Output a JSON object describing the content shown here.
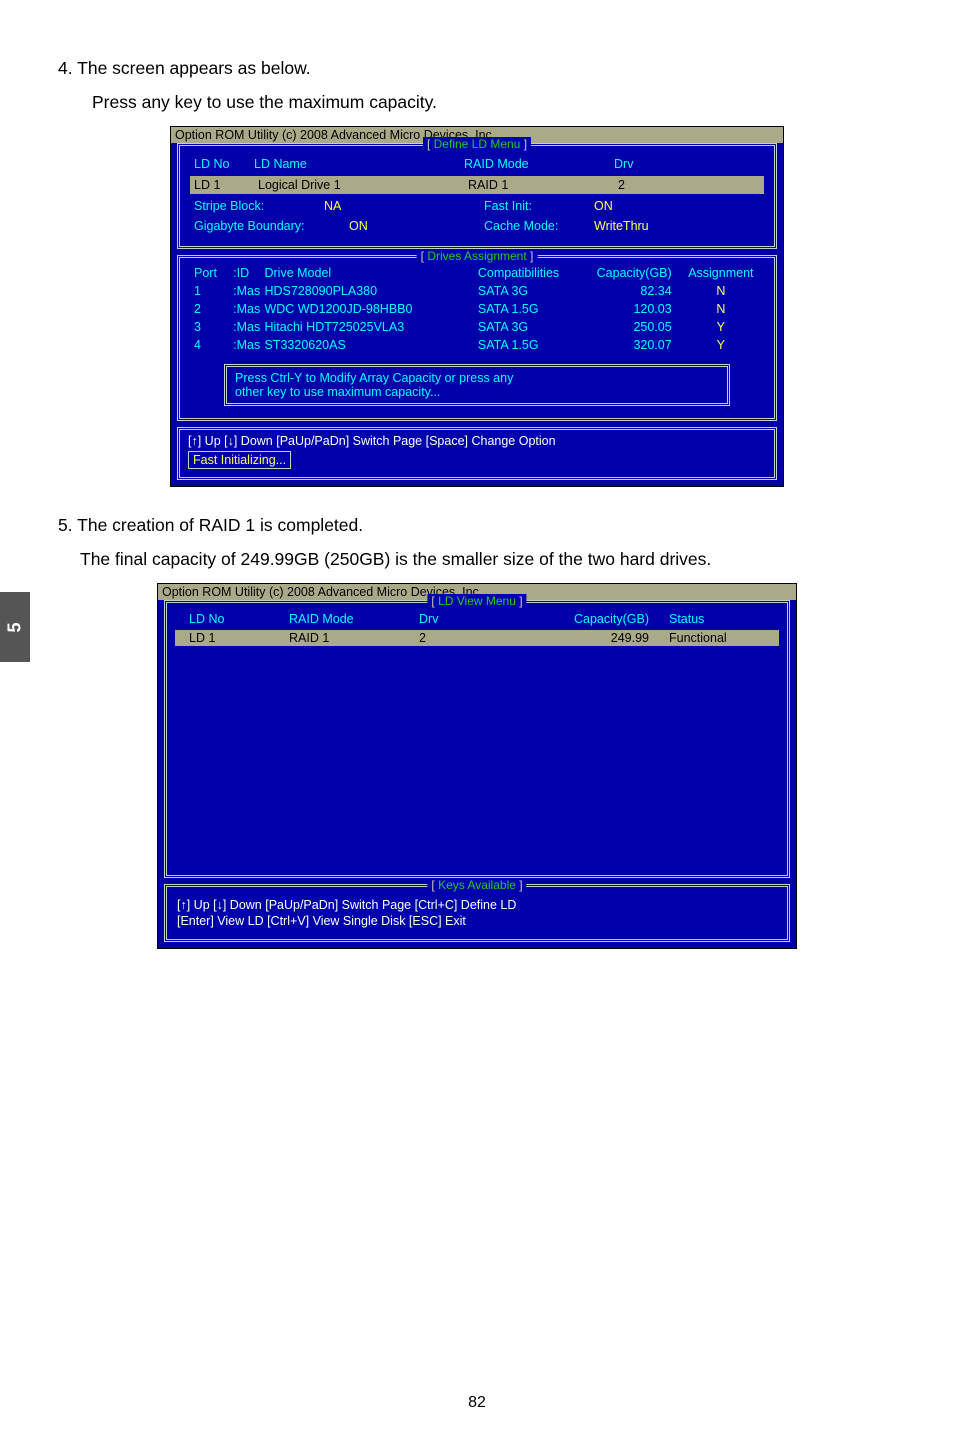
{
  "sidebar_chapter": "5",
  "step4": {
    "num": "4.",
    "line1": "The screen appears as below.",
    "line2": "Press any key to use the maximum capacity."
  },
  "bios1": {
    "title": "Option ROM Utility (c) 2008 Advanced Micro Devices, Inc.",
    "frame1_label": "Define LD Menu",
    "headers": {
      "ldno": "LD No",
      "ldname": "LD Name",
      "raidmode": "RAID Mode",
      "drv": "Drv"
    },
    "selected": {
      "ldno": "LD  1",
      "ldname": "Logical Drive 1",
      "raidmode": "RAID 1",
      "drv": "2"
    },
    "stripe": {
      "label": "Stripe Block:",
      "value": "NA",
      "fastinit_l": "Fast Init:",
      "fastinit_v": "ON"
    },
    "gigabyte": {
      "label": "Gigabyte Boundary:",
      "value": "ON",
      "cache_l": "Cache Mode:",
      "cache_v": "WriteThru"
    },
    "drives_label": "Drives Assignment",
    "drv_headers": {
      "port": "Port",
      "id": ":ID",
      "model": "Drive Model",
      "comp": "Compatibilities",
      "cap": "Capacity(GB)",
      "asg": "Assignment"
    },
    "drives": [
      {
        "port": "1",
        "id": ":Mas",
        "model": "HDS728090PLA380",
        "comp": "SATA  3G",
        "cap": "82.34",
        "asg": "N"
      },
      {
        "port": "2",
        "id": ":Mas",
        "model": "WDC WD1200JD-98HBB0",
        "comp": "SATA  1.5G",
        "cap": "120.03",
        "asg": "N"
      },
      {
        "port": "3",
        "id": ":Mas",
        "model": "Hitachi HDT725025VLA3",
        "comp": "SATA  3G",
        "cap": "250.05",
        "asg": "Y"
      },
      {
        "port": "4",
        "id": ":Mas",
        "model": "ST3320620AS",
        "comp": "SATA  1.5G",
        "cap": "320.07",
        "asg": "Y"
      }
    ],
    "inner_msg1": "Press Ctrl-Y to Modify Array Capacity or press any",
    "inner_msg2": "other key to use maximum capacity...",
    "footer": "[↑] Up    [↓] Down    [PaUp/PaDn] Switch Page    [Space] Change Option",
    "fast_init_l": "Fast  Initializing",
    "fast_init_dots": "..."
  },
  "step5": {
    "num": "5.",
    "line1": "The creation of RAID 1 is completed.",
    "line2": "The final capacity of 249.99GB (250GB) is the smaller size of the two hard drives."
  },
  "bios2": {
    "title": "Option ROM Utility (c) 2008 Advanced Micro Devices, Inc.",
    "frame_label": "LD View Menu",
    "headers": {
      "ldno": "LD No",
      "mode": "RAID Mode",
      "drv": "Drv",
      "cap": "Capacity(GB)",
      "status": "Status"
    },
    "row": {
      "ldno": "LD   1",
      "mode": "RAID 1",
      "drv": "2",
      "cap": "249.99",
      "status": "Functional"
    },
    "keys_label": "Keys Available",
    "hint1": "[↑] Up    [↓] Down    [PaUp/PaDn] Switch Page    [Ctrl+C] Define LD",
    "hint2": "[Enter] View LD    [Ctrl+V] View Single Disk    [ESC] Exit"
  },
  "page_number": "82"
}
